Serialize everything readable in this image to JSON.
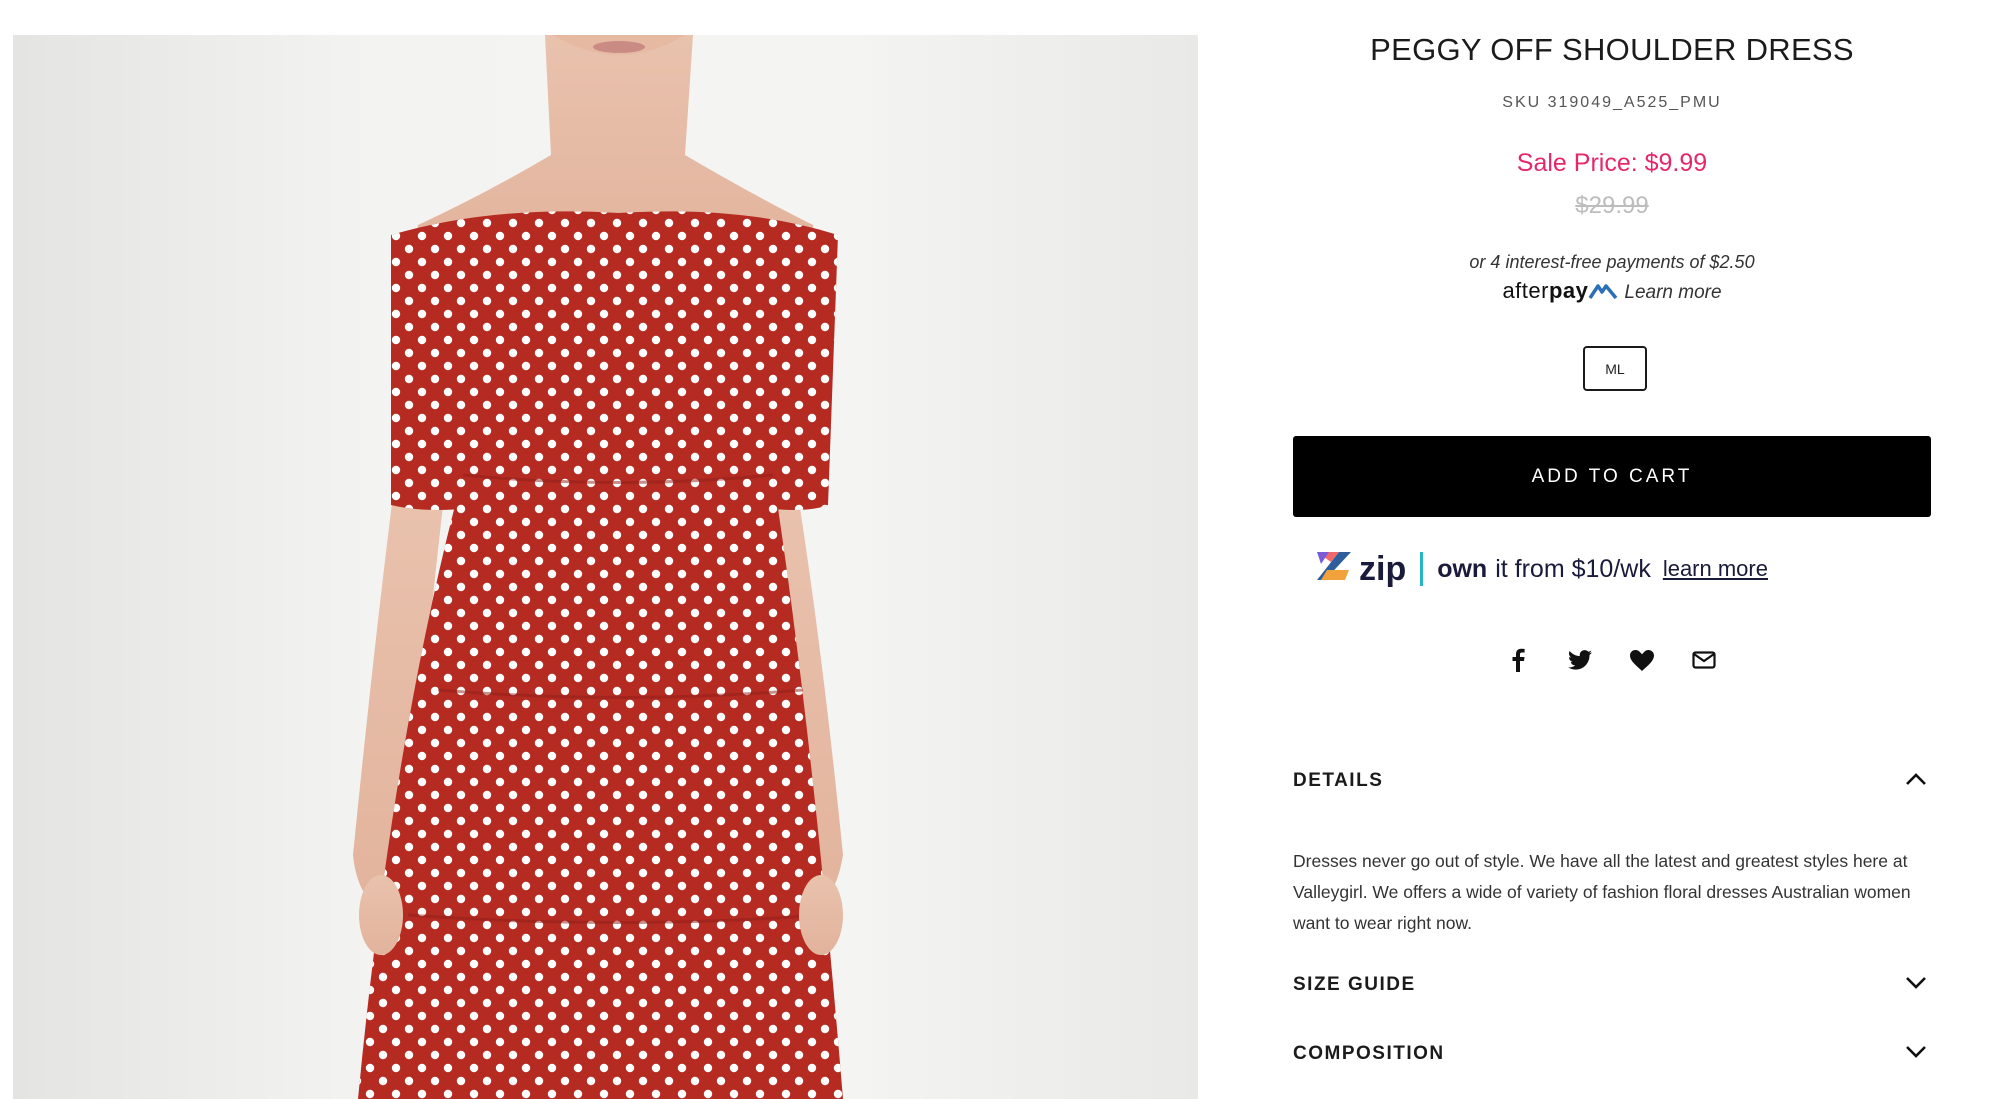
{
  "product": {
    "title": "PEGGY OFF SHOULDER DRESS",
    "sku": "SKU 319049_A525_PMU",
    "sale_price": "Sale Price: $9.99",
    "original_price": "$29.99"
  },
  "afterpay": {
    "installments": "or 4 interest-free payments of $2.50",
    "logo_light": "after",
    "logo_bold": "pay",
    "learn_more": "Learn more"
  },
  "size": {
    "selected": "ML"
  },
  "cart": {
    "label": "ADD TO CART"
  },
  "zip": {
    "logo": "zip",
    "own": "own",
    "text": "it from $10/wk",
    "learn_more": "learn more"
  },
  "share": {
    "icons": [
      "facebook-icon",
      "twitter-icon",
      "heart-icon",
      "mail-icon"
    ]
  },
  "accordion": {
    "details": {
      "title": "DETAILS",
      "body": "Dresses never go out of style. We have all the latest and greatest styles here at Valleygirl. We offers a wide of variety of fashion floral dresses Australian women want to wear right now."
    },
    "size_guide": {
      "title": "SIZE GUIDE"
    },
    "composition": {
      "title": "COMPOSITION"
    }
  },
  "colors": {
    "sale": "#e4286b",
    "button": "#000000",
    "dress": "#b52b22",
    "zip_accent": "#27b5c8"
  }
}
